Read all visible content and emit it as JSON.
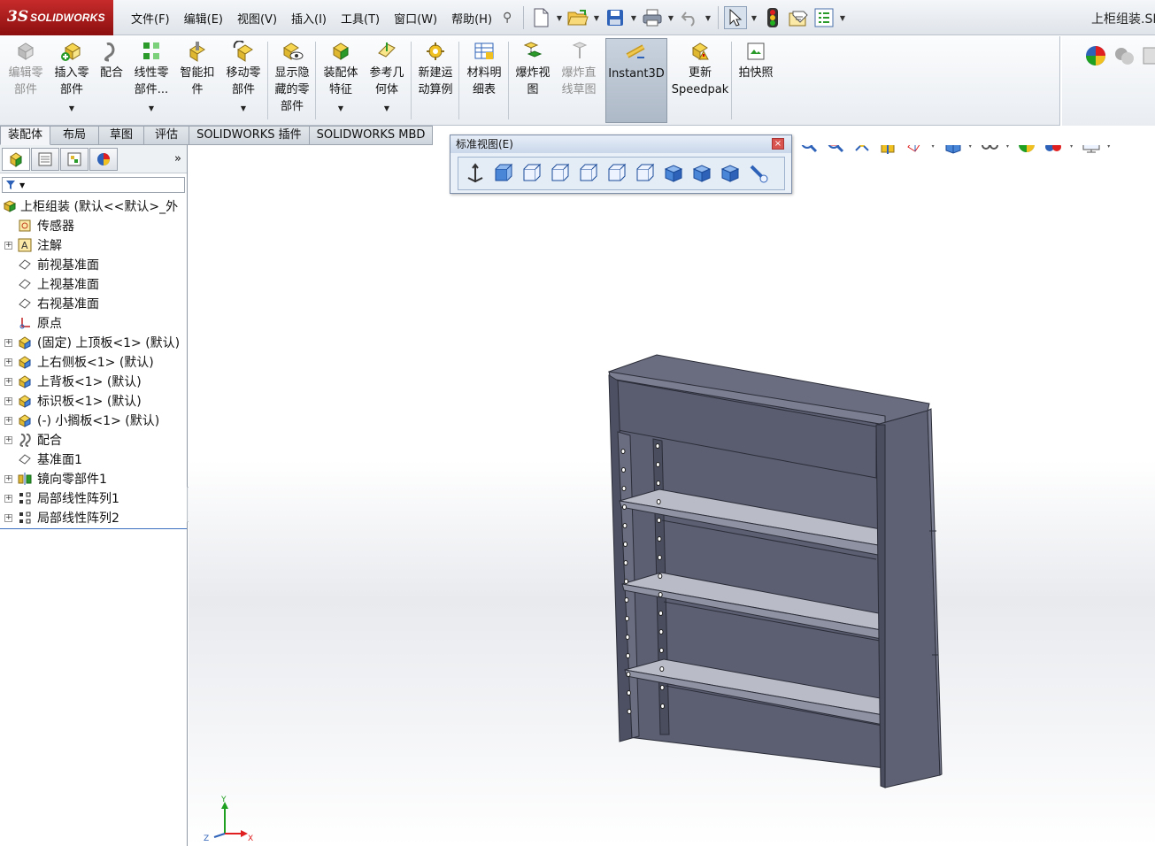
{
  "app": {
    "brand_ds": "3S",
    "brand_name": "SOLIDWORKS",
    "document_title": "上柜组装.SL"
  },
  "menu": [
    "文件(F)",
    "编辑(E)",
    "视图(V)",
    "插入(I)",
    "工具(T)",
    "窗口(W)",
    "帮助(H)"
  ],
  "quick_access": [
    "new-document-icon",
    "open-icon",
    "save-icon",
    "print-icon",
    "undo-icon",
    "select-arrow-icon",
    "rebuild-icon",
    "file-properties-icon",
    "options-icon"
  ],
  "commands": [
    {
      "label": "编辑零\n部件",
      "icon": "edit-component-icon",
      "enabled": false
    },
    {
      "label": "插入零\n部件",
      "icon": "insert-component-icon",
      "enabled": true,
      "dropdown": true
    },
    {
      "label": "配合",
      "icon": "mate-icon",
      "enabled": true
    },
    {
      "label": "线性零\n部件...",
      "icon": "linear-pattern-icon",
      "enabled": true,
      "dropdown": true
    },
    {
      "label": "智能扣\n件",
      "icon": "smart-fasteners-icon",
      "enabled": true
    },
    {
      "label": "移动零\n部件",
      "icon": "move-component-icon",
      "enabled": true,
      "dropdown": true
    },
    {
      "label": "显示隐\n藏的零\n部件",
      "icon": "show-hidden-icon",
      "enabled": true
    },
    {
      "label": "装配体\n特征",
      "icon": "assembly-features-icon",
      "enabled": true,
      "dropdown": true
    },
    {
      "label": "参考几\n何体",
      "icon": "reference-geometry-icon",
      "enabled": true,
      "dropdown": true
    },
    {
      "label": "新建运\n动算例",
      "icon": "motion-study-icon",
      "enabled": true
    },
    {
      "label": "材料明\n细表",
      "icon": "bom-icon",
      "enabled": true
    },
    {
      "label": "爆炸视\n图",
      "icon": "exploded-view-icon",
      "enabled": true
    },
    {
      "label": "爆炸直\n线草图",
      "icon": "explode-line-sketch-icon",
      "enabled": false
    },
    {
      "label": "Instant3D",
      "icon": "instant3d-icon",
      "enabled": true,
      "active": true
    },
    {
      "label": "更新\nSpeedpak",
      "icon": "speedpak-icon",
      "enabled": true
    },
    {
      "label": "拍快照",
      "icon": "snapshot-icon",
      "enabled": true
    }
  ],
  "tabs": [
    "装配体",
    "布局",
    "草图",
    "评估",
    "SOLIDWORKS 插件",
    "SOLIDWORKS MBD"
  ],
  "active_tab": "装配体",
  "panel": {
    "tabs": [
      "featuremanager-icon",
      "propertymanager-icon",
      "configurationmanager-icon",
      "displaymanager-icon"
    ],
    "more": "»",
    "filter_icon": "filter-icon",
    "tree": [
      {
        "label": "上柜组装  (默认<<默认>_外",
        "icon": "assembly-icon",
        "expand": false,
        "root": true
      },
      {
        "label": "传感器",
        "icon": "sensor-icon",
        "expand": false
      },
      {
        "label": "注解",
        "icon": "annotation-icon",
        "expand": true
      },
      {
        "label": "前视基准面",
        "icon": "plane-icon",
        "expand": false
      },
      {
        "label": "上视基准面",
        "icon": "plane-icon",
        "expand": false
      },
      {
        "label": "右视基准面",
        "icon": "plane-icon",
        "expand": false
      },
      {
        "label": "原点",
        "icon": "origin-icon",
        "expand": false
      },
      {
        "label": "(固定) 上顶板<1> (默认)",
        "icon": "part-icon",
        "expand": true
      },
      {
        "label": "上右侧板<1> (默认)",
        "icon": "part-icon",
        "expand": true
      },
      {
        "label": "上背板<1> (默认)",
        "icon": "part-icon",
        "expand": true
      },
      {
        "label": "标识板<1> (默认)",
        "icon": "part-icon",
        "expand": true
      },
      {
        "label": "(-) 小搁板<1> (默认)",
        "icon": "part-icon",
        "expand": true
      },
      {
        "label": "配合",
        "icon": "mates-folder-icon",
        "expand": true
      },
      {
        "label": "基准面1",
        "icon": "plane-icon",
        "expand": false
      },
      {
        "label": "镜向零部件1",
        "icon": "mirror-component-icon",
        "expand": true
      },
      {
        "label": "局部线性阵列1",
        "icon": "local-pattern-icon",
        "expand": true
      },
      {
        "label": "局部线性阵列2",
        "icon": "local-pattern-icon",
        "expand": true
      }
    ]
  },
  "view_toolbar": [
    "zoom-to-fit-icon",
    "zoom-area-icon",
    "previous-view-icon",
    "section-view-icon",
    "view-orientation-icon",
    "display-style-icon",
    "hide-show-items-icon",
    "edit-appearance-icon",
    "apply-scene-icon",
    "view-settings-icon"
  ],
  "standard_views": {
    "title": "标准视图(E)",
    "buttons": [
      "normal-to-icon",
      "front-view-icon",
      "back-view-icon",
      "left-view-icon",
      "right-view-icon",
      "top-view-icon",
      "bottom-view-icon",
      "isometric-view-icon",
      "trimetric-view-icon",
      "dimetric-view-icon",
      "link-views-icon"
    ]
  },
  "triad": {
    "x": "X",
    "y": "Y",
    "z": "Z"
  },
  "colors": {
    "model": "#5c5f72",
    "shelf": "#b9bbc6",
    "brand_red": "#b01e1e",
    "selection_blue": "#3c6fc0"
  }
}
